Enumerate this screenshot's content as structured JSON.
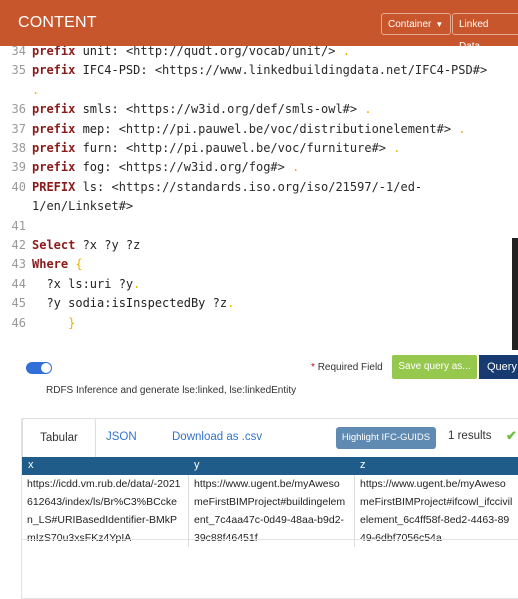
{
  "header": {
    "title": "CONTENT",
    "container_label": "Container",
    "linked_data_label": "Linked Data",
    "color": "#c8562d"
  },
  "editor": {
    "lines": [
      {
        "n": "34",
        "kw": "prefix",
        "pre": " unit:",
        "uri": " <http://qudt.org/vocab/unit/>",
        "dot": " ."
      },
      {
        "n": "35",
        "kw": "prefix",
        "pre": " IFC4-PSD:",
        "uri": " <https://www.linkedbuildingdata.net/IFC4-PSD#>",
        "dot": ""
      },
      {
        "n": "",
        "kw": "",
        "pre": "",
        "uri": "",
        "dot": "."
      },
      {
        "n": "36",
        "kw": "prefix",
        "pre": " smls:",
        "uri": " <https://w3id.org/def/smls-owl#>",
        "dot": " ."
      },
      {
        "n": "37",
        "kw": "prefix",
        "pre": " mep:",
        "uri": " <http://pi.pauwel.be/voc/distributionelement#>",
        "dot": " ."
      },
      {
        "n": "38",
        "kw": "prefix",
        "pre": " furn:",
        "uri": " <http://pi.pauwel.be/voc/furniture#>",
        "dot": " ."
      },
      {
        "n": "39",
        "kw": "prefix",
        "pre": " fog:",
        "uri": " <https://w3id.org/fog#>",
        "dot": " ."
      },
      {
        "n": "40",
        "kw": "PREFIX",
        "pre": " ls:",
        "uri": " <https://standards.iso.org/iso/21597/-1/ed-",
        "dot": ""
      },
      {
        "n": "",
        "kw": "",
        "pre": "",
        "uri": "1/en/Linkset#>",
        "dot": ""
      },
      {
        "n": "41",
        "kw": "",
        "pre": "",
        "uri": "",
        "dot": ""
      },
      {
        "n": "42",
        "kw": "Select",
        "pre": " ?x ?y ?z",
        "uri": "",
        "dot": ""
      },
      {
        "n": "43",
        "kw": "Where",
        "pre": "",
        "uri": "",
        "dot": " {"
      },
      {
        "n": "44",
        "kw": "",
        "pre": "  ?x ls:uri ?y",
        "uri": "",
        "dot": "."
      },
      {
        "n": "45",
        "kw": "",
        "pre": "  ?y sodia:isInspectedBy ?z",
        "uri": "",
        "dot": "."
      },
      {
        "n": "46",
        "kw": "",
        "pre": "",
        "uri": "",
        "dot": "     }"
      }
    ]
  },
  "controls": {
    "required_star": "*",
    "required_label": "Required Field",
    "save_query_label": "Save query as...",
    "query_label": "Query",
    "rdfs_label": "RDFS Inference and generate lse:linked, lse:linkedEntity",
    "toggle_on": true
  },
  "results": {
    "tabs": [
      "Tabular",
      "JSON",
      "Download as .csv"
    ],
    "highlight_label": "Highlight IFC-GUIDS",
    "count_label": "1 results",
    "columns": [
      "x",
      "y",
      "z"
    ],
    "rows": [
      [
        "https://icdd.vm.rub.de/data/-2021612643/index/ls/Br%C3%BCcken_LS#URIBasedIdentifier-BMkPmIzS70u3xsFKz4YpIA",
        "https://www.ugent.be/myAwesomeFirstBIMProject#buildingelement_7c4aa47c-0d49-48aa-b9d2-39c88f46451f",
        "https://www.ugent.be/myAwesomeFirstBIMProject#ifcowl_ifccivilelement_6c4ff58f-8ed2-4463-8949-6dbf7056c54a"
      ]
    ]
  }
}
